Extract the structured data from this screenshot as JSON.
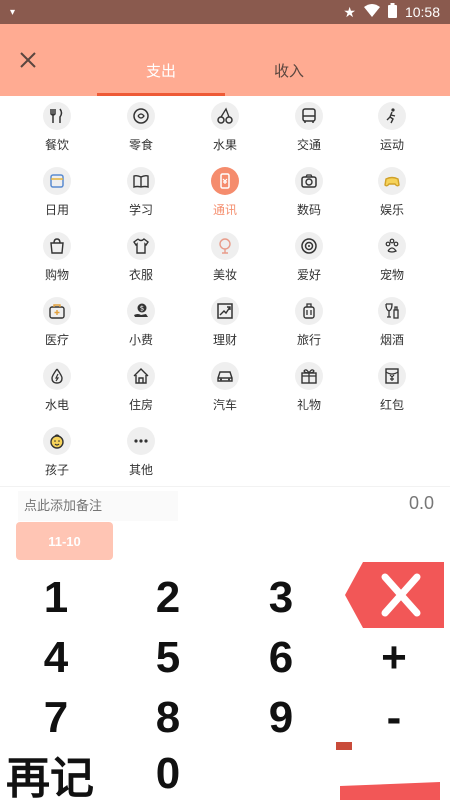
{
  "status": {
    "time": "10:58"
  },
  "tabs": {
    "expense": "支出",
    "income": "收入"
  },
  "categories": [
    {
      "label": "餐饮",
      "icon": "utensils-icon"
    },
    {
      "label": "零食",
      "icon": "snack-icon"
    },
    {
      "label": "水果",
      "icon": "cherry-icon"
    },
    {
      "label": "交通",
      "icon": "bus-icon"
    },
    {
      "label": "运动",
      "icon": "running-icon"
    },
    {
      "label": "日用",
      "icon": "daily-icon"
    },
    {
      "label": "学习",
      "icon": "book-icon"
    },
    {
      "label": "通讯",
      "icon": "phone-icon",
      "active": true
    },
    {
      "label": "数码",
      "icon": "camera-icon"
    },
    {
      "label": "娱乐",
      "icon": "gamepad-icon"
    },
    {
      "label": "购物",
      "icon": "bag-icon"
    },
    {
      "label": "衣服",
      "icon": "shirt-icon"
    },
    {
      "label": "美妆",
      "icon": "mirror-icon"
    },
    {
      "label": "爱好",
      "icon": "target-icon"
    },
    {
      "label": "宠物",
      "icon": "paw-icon"
    },
    {
      "label": "医疗",
      "icon": "medkit-icon"
    },
    {
      "label": "小费",
      "icon": "tip-icon"
    },
    {
      "label": "理财",
      "icon": "chart-icon"
    },
    {
      "label": "旅行",
      "icon": "luggage-icon"
    },
    {
      "label": "烟酒",
      "icon": "wine-icon"
    },
    {
      "label": "水电",
      "icon": "water-icon"
    },
    {
      "label": "住房",
      "icon": "house-icon"
    },
    {
      "label": "汽车",
      "icon": "car-icon"
    },
    {
      "label": "礼物",
      "icon": "gift-icon"
    },
    {
      "label": "红包",
      "icon": "redpacket-icon"
    },
    {
      "label": "孩子",
      "icon": "child-icon"
    },
    {
      "label": "其他",
      "icon": "more-icon"
    }
  ],
  "note": {
    "placeholder": "点此添加备注"
  },
  "amount": "0.0",
  "date": "11-10",
  "keypad": {
    "k1": "1",
    "k2": "2",
    "k3": "3",
    "k4": "4",
    "k5": "5",
    "k6": "6",
    "plus": "+",
    "k7": "7",
    "k8": "8",
    "k9": "9",
    "minus": "-",
    "k0": "0",
    "again": "再记"
  },
  "colors": {
    "header": "#ffab92",
    "accent": "#ee5a36",
    "delete": "#f25757",
    "statusbar": "#8a5a4e"
  }
}
